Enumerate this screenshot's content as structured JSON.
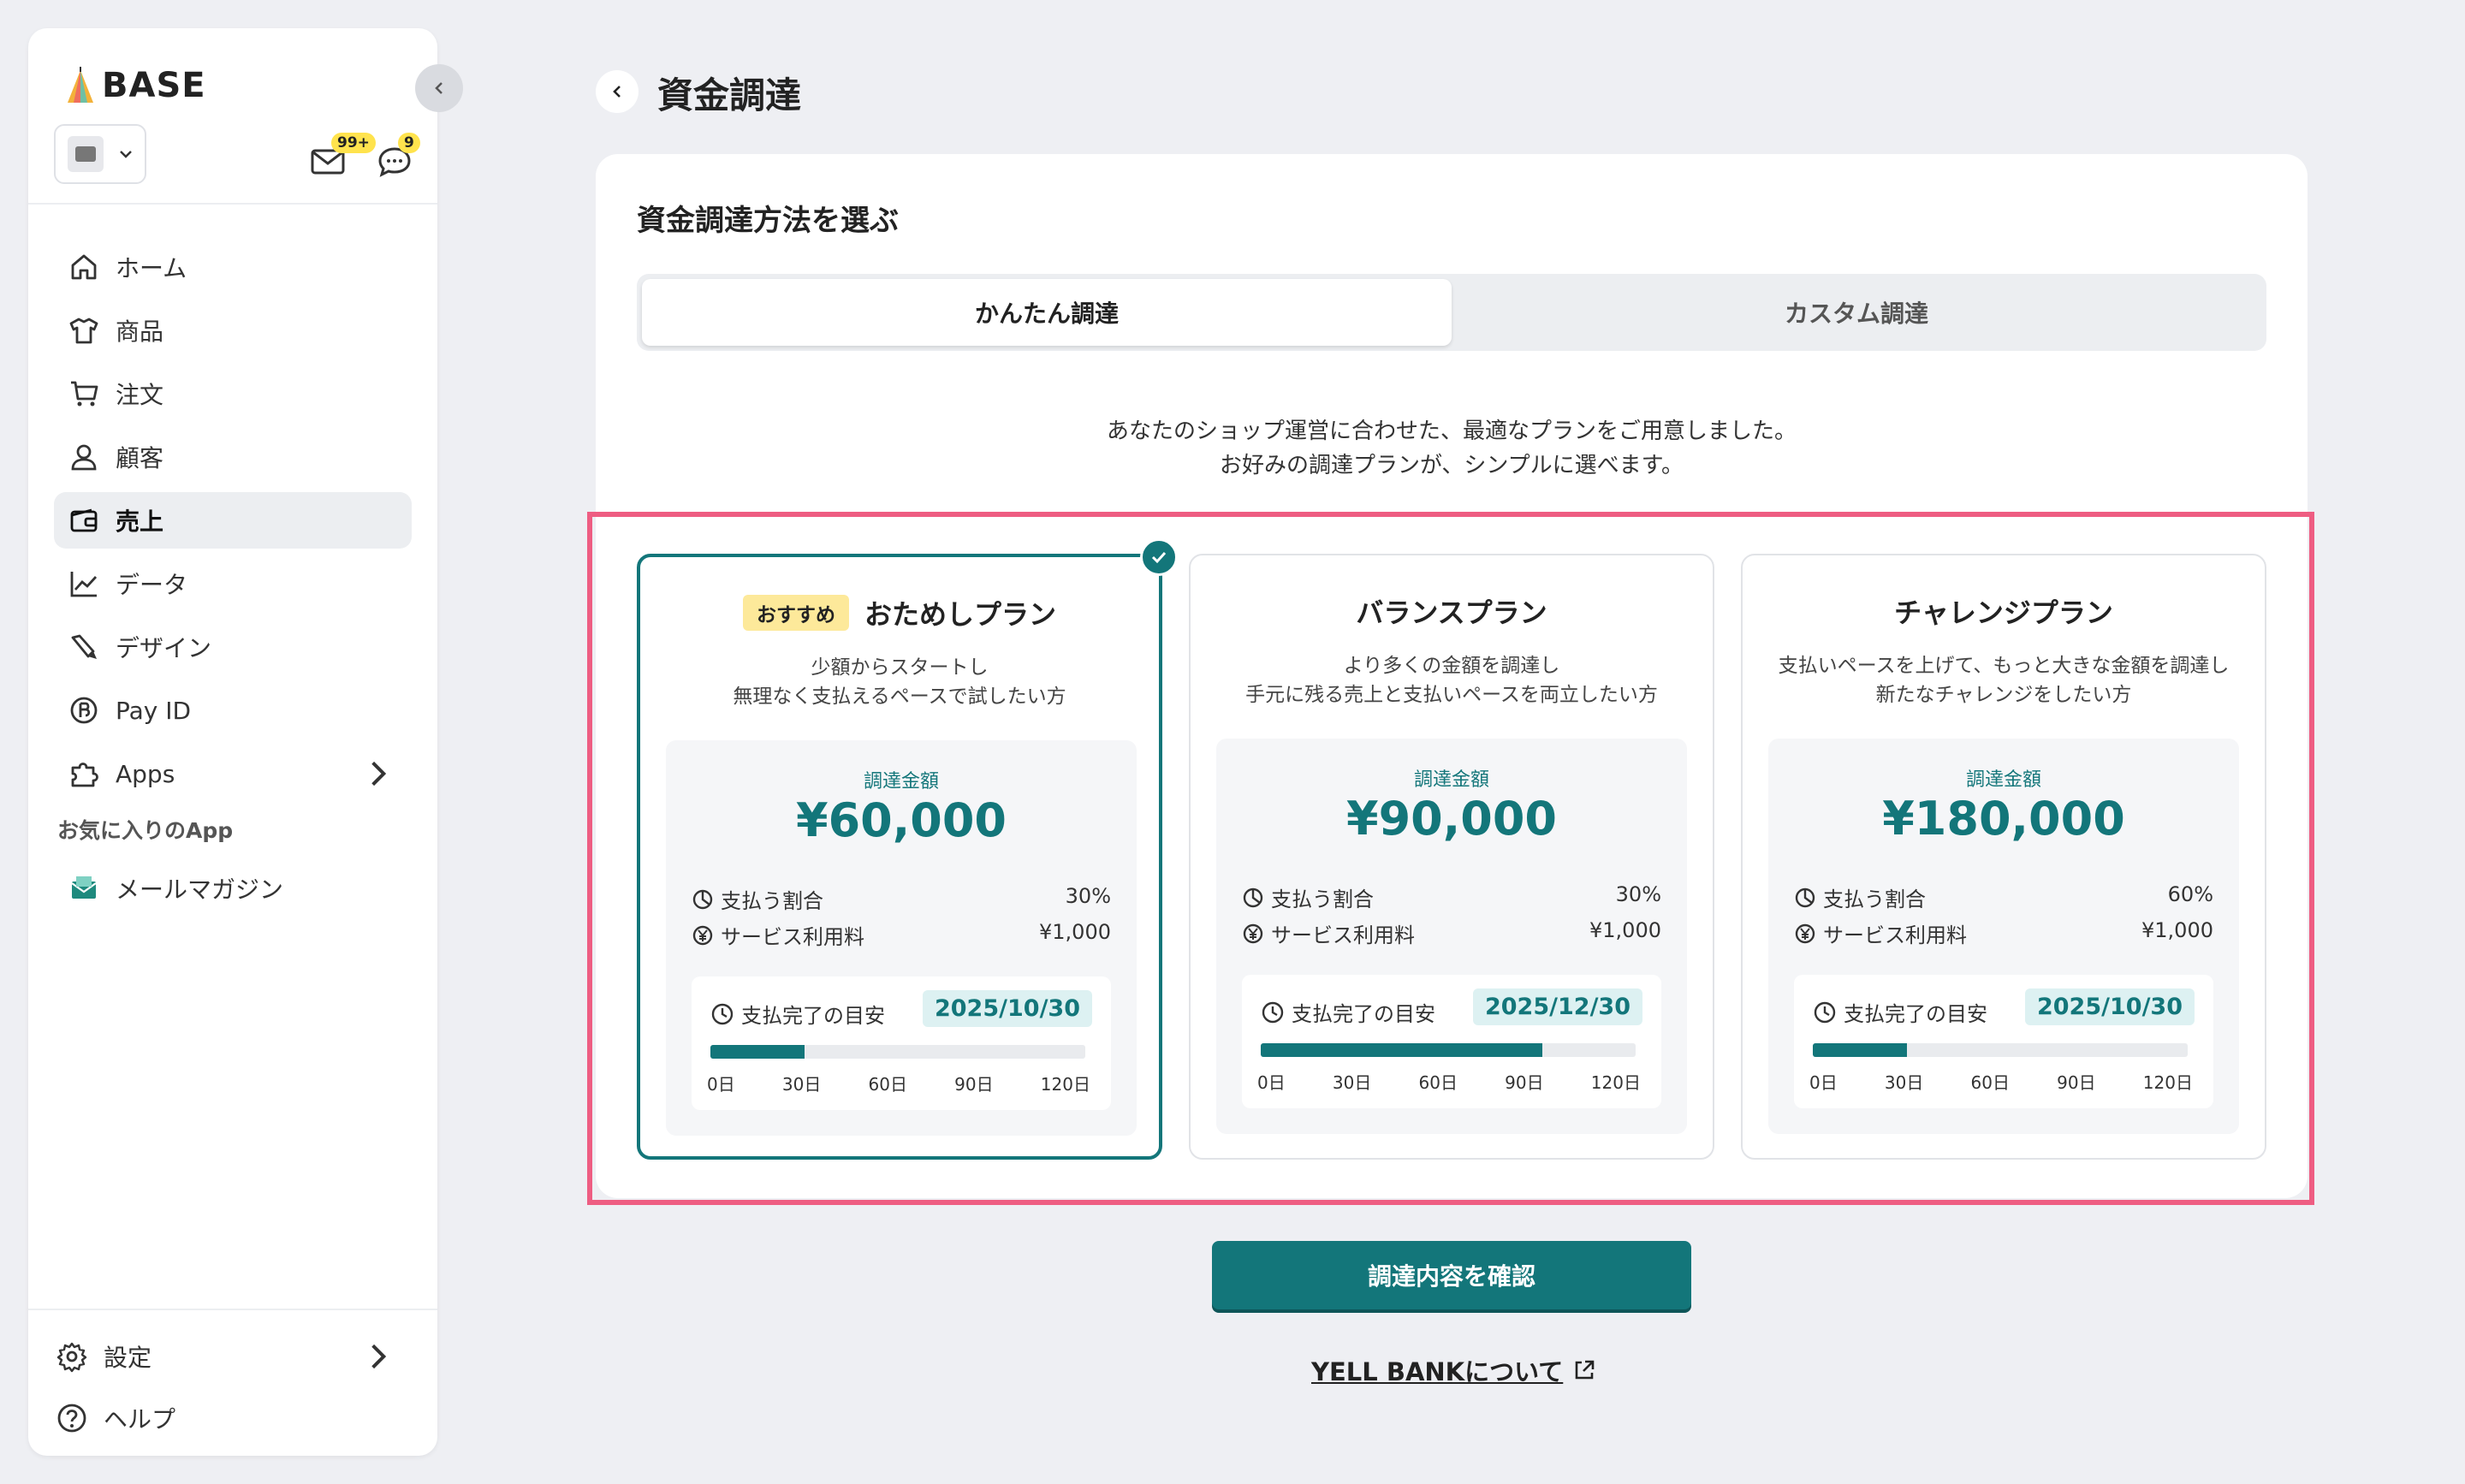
{
  "brand": {
    "name": "BASE"
  },
  "header_badges": {
    "mail": "99+",
    "chat": "9"
  },
  "sidebar": {
    "items": [
      {
        "label": "ホーム",
        "icon": "home-icon"
      },
      {
        "label": "商品",
        "icon": "shirt-icon"
      },
      {
        "label": "注文",
        "icon": "cart-icon"
      },
      {
        "label": "顧客",
        "icon": "user-icon"
      },
      {
        "label": "売上",
        "icon": "wallet-icon",
        "active": true
      },
      {
        "label": "データ",
        "icon": "chart-icon"
      },
      {
        "label": "デザイン",
        "icon": "brush-icon"
      },
      {
        "label": "Pay ID",
        "icon": "payid-icon"
      },
      {
        "label": "Apps",
        "icon": "puzzle-icon"
      }
    ],
    "favorites_label": "お気に入りのApp",
    "favorites": [
      {
        "label": "メールマガジン",
        "icon": "mail-magazine-icon"
      }
    ],
    "bottom": [
      {
        "label": "設定",
        "icon": "gear-icon"
      },
      {
        "label": "ヘルプ",
        "icon": "help-icon"
      }
    ]
  },
  "page": {
    "title": "資金調達"
  },
  "panel": {
    "title": "資金調達方法を選ぶ",
    "tabs": [
      {
        "label": "かんたん調達",
        "active": true
      },
      {
        "label": "カスタム調達"
      }
    ],
    "intro_line1": "あなたのショップ運営に合わせた、最適なプランをご用意しました。",
    "intro_line2": "お好みの調達プランが、シンプルに選べます。"
  },
  "plans": [
    {
      "badge": "おすすめ",
      "name": "おためしプラン",
      "desc1": "少額からスタートし",
      "desc2": "無理なく支払えるペースで試したい方",
      "amount_label": "調達金額",
      "amount": "¥60,000",
      "rate_label": "支払う割合",
      "rate": "30%",
      "fee_label": "サービス利用料",
      "fee": "¥1,000",
      "schedule_label": "支払完了の目安",
      "schedule_date": "2025/10/30",
      "progress_days": 30,
      "selected": true
    },
    {
      "name": "バランスプラン",
      "desc1": "より多くの金額を調達し",
      "desc2": "手元に残る売上と支払いペースを両立したい方",
      "amount_label": "調達金額",
      "amount": "¥90,000",
      "rate_label": "支払う割合",
      "rate": "30%",
      "fee_label": "サービス利用料",
      "fee": "¥1,000",
      "schedule_label": "支払完了の目安",
      "schedule_date": "2025/12/30",
      "progress_days": 90
    },
    {
      "name": "チャレンジプラン",
      "desc1": "支払いペースを上げて、もっと大きな金額を調達し",
      "desc2": "新たなチャレンジをしたい方",
      "amount_label": "調達金額",
      "amount": "¥180,000",
      "rate_label": "支払う割合",
      "rate": "60%",
      "fee_label": "サービス利用料",
      "fee": "¥1,000",
      "schedule_label": "支払完了の目安",
      "schedule_date": "2025/10/30",
      "progress_days": 30
    }
  ],
  "progress_max_days": 120,
  "ticks": [
    "0日",
    "30日",
    "60日",
    "90日",
    "120日"
  ],
  "actions": {
    "confirm": "調達内容を確認",
    "link": "YELL BANKについて"
  },
  "colors": {
    "accent": "#13767a",
    "highlight": "#ee5d82",
    "badge": "#ffe34d"
  }
}
